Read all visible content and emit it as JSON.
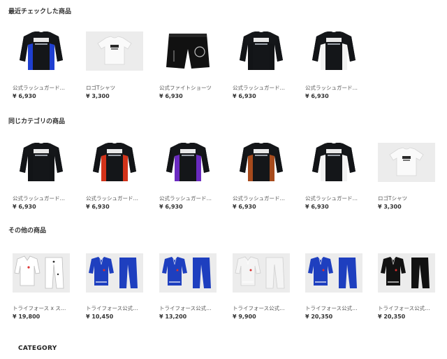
{
  "sections": [
    {
      "title": "最近チェックした商品",
      "items": [
        {
          "name": "公式ラッシュガード…",
          "price": "¥ 6,930",
          "kind": "rash",
          "accent": "#1f3fd0",
          "sleeve": "#121417"
        },
        {
          "name": "ロゴTシャツ",
          "price": "¥ 3,300",
          "kind": "tee"
        },
        {
          "name": "公式ファイトショーツ",
          "price": "¥ 6,930",
          "kind": "shorts"
        },
        {
          "name": "公式ラッシュガード…",
          "price": "¥ 6,930",
          "kind": "rash",
          "accent": "#121417",
          "sleeve": "#121417"
        },
        {
          "name": "公式ラッシュガード…",
          "price": "¥ 6,930",
          "kind": "rash",
          "accent": "#f2f2f2",
          "sleeve": "#121417"
        }
      ]
    },
    {
      "title": "同じカテゴリの商品",
      "items": [
        {
          "name": "公式ラッシュガード…",
          "price": "¥ 6,930",
          "kind": "rash",
          "accent": "#121417",
          "sleeve": "#121417"
        },
        {
          "name": "公式ラッシュガード…",
          "price": "¥ 6,930",
          "kind": "rash",
          "accent": "#d3331a",
          "sleeve": "#121417"
        },
        {
          "name": "公式ラッシュガード…",
          "price": "¥ 6,930",
          "kind": "rash",
          "accent": "#6a2ac0",
          "sleeve": "#121417"
        },
        {
          "name": "公式ラッシュガード…",
          "price": "¥ 6,930",
          "kind": "rash",
          "accent": "#a64a1c",
          "sleeve": "#121417"
        },
        {
          "name": "公式ラッシュガード…",
          "price": "¥ 6,930",
          "kind": "rash",
          "accent": "#f2f2f2",
          "sleeve": "#121417"
        },
        {
          "name": "ロゴTシャツ",
          "price": "¥ 3,300",
          "kind": "tee"
        }
      ]
    },
    {
      "title": "その他の商品",
      "items": [
        {
          "name": "トライフォース x ス…",
          "price": "¥ 19,800",
          "kind": "gi-flat",
          "color": "#ffffff"
        },
        {
          "name": "トライフォース公式…",
          "price": "¥ 10,450",
          "kind": "gi",
          "color": "#1e3fbf"
        },
        {
          "name": "トライフォース公式…",
          "price": "¥ 13,200",
          "kind": "gi",
          "color": "#1e3fbf"
        },
        {
          "name": "トライフォース公式…",
          "price": "¥ 9,900",
          "kind": "gi",
          "color": "#f4f4f4"
        },
        {
          "name": "トライフォース公式…",
          "price": "¥ 20,350",
          "kind": "gi",
          "color": "#1e3fbf"
        },
        {
          "name": "トライフォース公式…",
          "price": "¥ 20,350",
          "kind": "gi",
          "color": "#121212"
        }
      ]
    }
  ],
  "category_heading": "CATEGORY"
}
